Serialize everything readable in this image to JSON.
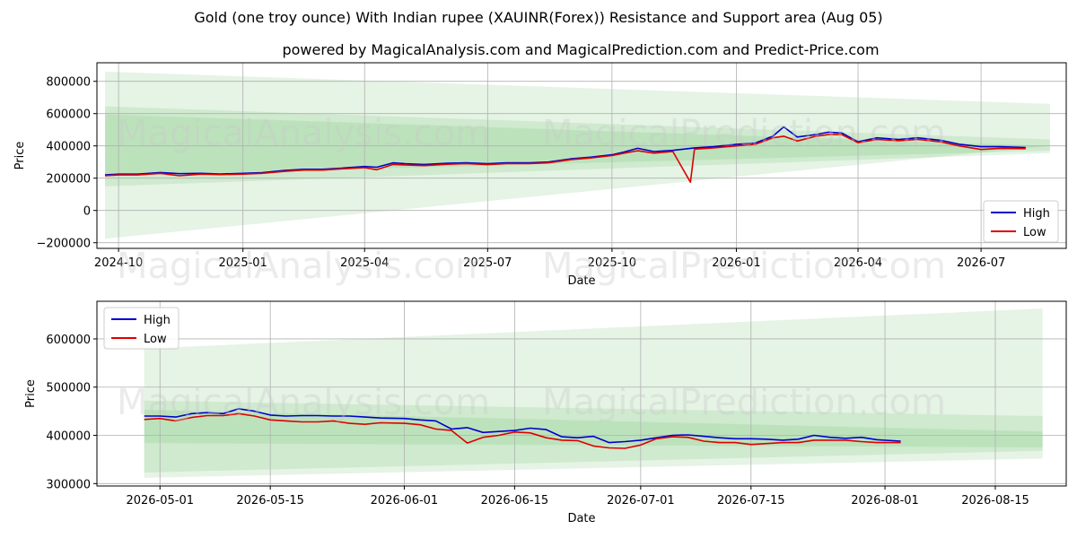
{
  "title": "Gold (one troy ounce) With Indian rupee (XAUINR(Forex)) Resistance and Support area (Aug 05)",
  "subtitle": "powered by MagicalAnalysis.com and MagicalPrediction.com and Predict-Price.com",
  "watermarks": [
    "MagicalAnalysis.com",
    "MagicalPrediction.com"
  ],
  "colors": {
    "high": "#0000cc",
    "low": "#dd0000",
    "band": "#5cb85c",
    "grid": "#b0b0b0"
  },
  "chart_data": [
    {
      "type": "line",
      "xlabel": "Date",
      "ylabel": "Price",
      "xlim": [
        "2024-09-15",
        "2026-09-02"
      ],
      "ylim": [
        -235000,
        915000
      ],
      "xticks": [
        "2024-10",
        "2025-01",
        "2025-04",
        "2025-07",
        "2025-10",
        "2026-01",
        "2026-04",
        "2026-07"
      ],
      "yticks": [
        -200000,
        0,
        200000,
        400000,
        600000,
        800000
      ],
      "ytick_labels": [
        "−200000",
        "0",
        "200000",
        "400000",
        "600000",
        "800000"
      ],
      "legend": "bottom-right",
      "grid": true,
      "series": [
        {
          "name": "High",
          "color": "#0000cc",
          "x": [
            "2024-09-21",
            "2024-10-01",
            "2024-10-15",
            "2024-11-01",
            "2024-11-15",
            "2024-12-01",
            "2024-12-15",
            "2025-01-01",
            "2025-01-15",
            "2025-02-01",
            "2025-02-15",
            "2025-03-01",
            "2025-03-15",
            "2025-04-01",
            "2025-04-10",
            "2025-04-22",
            "2025-05-01",
            "2025-05-15",
            "2025-06-01",
            "2025-06-15",
            "2025-07-01",
            "2025-07-15",
            "2025-08-01",
            "2025-08-15",
            "2025-09-01",
            "2025-09-15",
            "2025-10-01",
            "2025-10-10",
            "2025-10-20",
            "2025-11-01",
            "2025-11-15",
            "2025-12-01",
            "2025-12-15",
            "2026-01-01",
            "2026-01-15",
            "2026-01-28",
            "2026-02-05",
            "2026-02-15",
            "2026-03-01",
            "2026-03-10",
            "2026-03-20",
            "2026-04-01",
            "2026-04-15",
            "2026-05-01",
            "2026-05-15",
            "2026-06-01",
            "2026-06-15",
            "2026-07-01",
            "2026-07-15",
            "2026-08-03"
          ],
          "values": [
            220000,
            225000,
            225000,
            235000,
            228000,
            230000,
            226000,
            230000,
            234000,
            248000,
            255000,
            255000,
            262000,
            272000,
            268000,
            295000,
            290000,
            285000,
            292000,
            295000,
            290000,
            295000,
            295000,
            300000,
            320000,
            330000,
            345000,
            362000,
            385000,
            365000,
            372000,
            388000,
            395000,
            410000,
            418000,
            460000,
            518000,
            455000,
            470000,
            485000,
            480000,
            425000,
            450000,
            440000,
            450000,
            435000,
            410000,
            395000,
            395000,
            390000
          ]
        },
        {
          "name": "Low",
          "color": "#dd0000",
          "x": [
            "2024-09-21",
            "2024-10-01",
            "2024-10-15",
            "2024-11-01",
            "2024-11-15",
            "2024-12-01",
            "2024-12-15",
            "2025-01-01",
            "2025-01-15",
            "2025-02-01",
            "2025-02-15",
            "2025-03-01",
            "2025-03-15",
            "2025-04-01",
            "2025-04-10",
            "2025-04-22",
            "2025-05-01",
            "2025-05-15",
            "2025-06-01",
            "2025-06-15",
            "2025-07-01",
            "2025-07-15",
            "2025-08-01",
            "2025-08-15",
            "2025-09-01",
            "2025-09-15",
            "2025-10-01",
            "2025-10-10",
            "2025-10-20",
            "2025-11-01",
            "2025-11-15",
            "2025-11-28",
            "2025-12-01",
            "2025-12-15",
            "2026-01-01",
            "2026-01-15",
            "2026-01-28",
            "2026-02-05",
            "2026-02-15",
            "2026-03-01",
            "2026-03-10",
            "2026-03-20",
            "2026-04-01",
            "2026-04-15",
            "2026-05-01",
            "2026-05-15",
            "2026-06-01",
            "2026-06-15",
            "2026-07-01",
            "2026-07-15",
            "2026-08-03"
          ],
          "values": [
            215000,
            220000,
            220000,
            230000,
            215000,
            225000,
            222000,
            225000,
            230000,
            242000,
            250000,
            250000,
            258000,
            265000,
            252000,
            285000,
            282000,
            278000,
            286000,
            290000,
            284000,
            290000,
            290000,
            295000,
            315000,
            325000,
            340000,
            355000,
            370000,
            355000,
            365000,
            175000,
            380000,
            388000,
            400000,
            410000,
            450000,
            460000,
            430000,
            460000,
            470000,
            470000,
            420000,
            440000,
            432000,
            440000,
            425000,
            400000,
            378000,
            385000,
            383000
          ]
        }
      ],
      "bands": [
        {
          "x": [
            "2024-09-21",
            "2026-08-21"
          ],
          "upper": [
            860000,
            660000
          ],
          "lower": [
            -175000,
            400000
          ]
        },
        {
          "x": [
            "2024-09-21",
            "2026-08-21"
          ],
          "upper": [
            645000,
            440000
          ],
          "lower": [
            150000,
            355000
          ]
        },
        {
          "x": [
            "2024-09-21",
            "2026-08-21"
          ],
          "upper": [
            595000,
            400000
          ],
          "lower": [
            215000,
            370000
          ]
        }
      ]
    },
    {
      "type": "line",
      "xlabel": "Date",
      "ylabel": "Price",
      "xlim": [
        "2026-04-23",
        "2026-08-24"
      ],
      "ylim": [
        295000,
        678000
      ],
      "xticks": [
        "2026-05-01",
        "2026-05-15",
        "2026-06-01",
        "2026-06-15",
        "2026-07-01",
        "2026-07-15",
        "2026-08-01",
        "2026-08-15"
      ],
      "yticks": [
        300000,
        400000,
        500000,
        600000
      ],
      "ytick_labels": [
        "300000",
        "400000",
        "500000",
        "600000"
      ],
      "legend": "top-left",
      "grid": true,
      "series": [
        {
          "name": "High",
          "color": "#0000cc",
          "x": [
            "2026-04-29",
            "2026-05-01",
            "2026-05-03",
            "2026-05-05",
            "2026-05-07",
            "2026-05-09",
            "2026-05-11",
            "2026-05-13",
            "2026-05-15",
            "2026-05-17",
            "2026-05-19",
            "2026-05-21",
            "2026-05-23",
            "2026-05-25",
            "2026-05-27",
            "2026-05-29",
            "2026-06-01",
            "2026-06-03",
            "2026-06-05",
            "2026-06-07",
            "2026-06-09",
            "2026-06-11",
            "2026-06-13",
            "2026-06-15",
            "2026-06-17",
            "2026-06-19",
            "2026-06-21",
            "2026-06-23",
            "2026-06-25",
            "2026-06-27",
            "2026-06-29",
            "2026-07-01",
            "2026-07-03",
            "2026-07-05",
            "2026-07-07",
            "2026-07-09",
            "2026-07-11",
            "2026-07-13",
            "2026-07-15",
            "2026-07-17",
            "2026-07-19",
            "2026-07-21",
            "2026-07-23",
            "2026-07-25",
            "2026-07-27",
            "2026-07-29",
            "2026-07-31",
            "2026-08-03"
          ],
          "values": [
            440000,
            440000,
            438000,
            445000,
            447000,
            445000,
            455000,
            450000,
            442000,
            440000,
            441000,
            441000,
            440000,
            440000,
            438000,
            436000,
            435000,
            432000,
            430000,
            413000,
            416000,
            406000,
            408000,
            410000,
            415000,
            412000,
            397000,
            395000,
            398000,
            385000,
            387000,
            390000,
            395000,
            400000,
            401000,
            398000,
            395000,
            393000,
            393000,
            392000,
            390000,
            392000,
            400000,
            396000,
            394000,
            396000,
            391000,
            388000
          ]
        },
        {
          "name": "Low",
          "color": "#dd0000",
          "x": [
            "2026-04-29",
            "2026-05-01",
            "2026-05-03",
            "2026-05-05",
            "2026-05-07",
            "2026-05-09",
            "2026-05-11",
            "2026-05-13",
            "2026-05-15",
            "2026-05-17",
            "2026-05-19",
            "2026-05-21",
            "2026-05-23",
            "2026-05-25",
            "2026-05-27",
            "2026-05-29",
            "2026-06-01",
            "2026-06-03",
            "2026-06-05",
            "2026-06-07",
            "2026-06-09",
            "2026-06-11",
            "2026-06-13",
            "2026-06-15",
            "2026-06-17",
            "2026-06-19",
            "2026-06-21",
            "2026-06-23",
            "2026-06-25",
            "2026-06-27",
            "2026-06-29",
            "2026-07-01",
            "2026-07-03",
            "2026-07-05",
            "2026-07-07",
            "2026-07-09",
            "2026-07-11",
            "2026-07-13",
            "2026-07-15",
            "2026-07-17",
            "2026-07-19",
            "2026-07-21",
            "2026-07-23",
            "2026-07-25",
            "2026-07-27",
            "2026-07-29",
            "2026-07-31",
            "2026-08-03"
          ],
          "values": [
            433000,
            435000,
            430000,
            437000,
            441000,
            441000,
            445000,
            440000,
            432000,
            430000,
            428000,
            428000,
            430000,
            425000,
            423000,
            426000,
            425000,
            422000,
            413000,
            410000,
            384000,
            396000,
            400000,
            407000,
            405000,
            395000,
            390000,
            389000,
            378000,
            374000,
            373000,
            380000,
            393000,
            397000,
            396000,
            388000,
            385000,
            385000,
            381000,
            383000,
            385000,
            385000,
            390000,
            390000,
            390000,
            387000,
            385000,
            385000
          ]
        }
      ],
      "bands": [
        {
          "x": [
            "2026-04-29",
            "2026-08-21"
          ],
          "upper": [
            580000,
            663000
          ],
          "lower": [
            312000,
            352000
          ]
        },
        {
          "x": [
            "2026-04-29",
            "2026-08-21"
          ],
          "upper": [
            472000,
            440000
          ],
          "lower": [
            323000,
            368000
          ]
        },
        {
          "x": [
            "2026-04-29",
            "2026-08-21"
          ],
          "upper": [
            453000,
            408000
          ],
          "lower": [
            384000,
            375000
          ]
        }
      ]
    }
  ]
}
